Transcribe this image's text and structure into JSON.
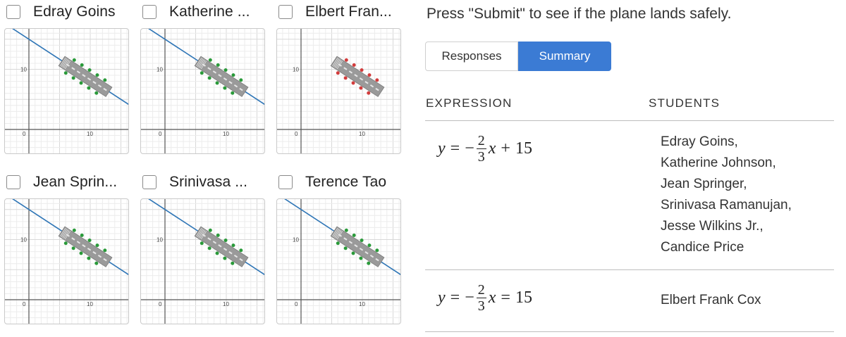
{
  "grid": {
    "cards": [
      {
        "name": "Edray Goins",
        "status": "pass"
      },
      {
        "name": "Katherine ...",
        "status": "pass"
      },
      {
        "name": "Elbert Fran...",
        "status": "fail"
      },
      {
        "name": "Jean Sprin...",
        "status": "pass"
      },
      {
        "name": "Srinivasa ...",
        "status": "pass"
      },
      {
        "name": "Terence Tao",
        "status": "pass"
      }
    ],
    "axis_labels": {
      "y10": "10",
      "origin": "0",
      "x10": "10"
    }
  },
  "colors": {
    "line": "#2e75b6",
    "pass_dot": "#2a9a3a",
    "fail_dot": "#d23c3c",
    "plane": "#9a9a9a",
    "accent": "#3b7bd4"
  },
  "panel": {
    "prompt": "Press \"Submit\" to see if the plane lands safely.",
    "tabs": {
      "responses": "Responses",
      "summary": "Summary"
    },
    "headers": {
      "expression": "EXPRESSION",
      "students": "STUDENTS"
    },
    "rows": [
      {
        "expr": {
          "lhs": "y",
          "eq": "=",
          "sign": "−",
          "num": "2",
          "den": "3",
          "var": "x",
          "op": "+",
          "const": "15"
        },
        "students": [
          "Edray Goins,",
          "Katherine Johnson,",
          "Jean Springer,",
          "Srinivasa Ramanujan,",
          "Jesse Wilkins Jr.,",
          "Candice Price"
        ]
      },
      {
        "expr": {
          "lhs": "y",
          "eq": "=",
          "sign": "−",
          "num": "2",
          "den": "3",
          "var": "x",
          "op": "=",
          "const": "15"
        },
        "students": [
          "Elbert Frank Cox"
        ]
      }
    ]
  }
}
